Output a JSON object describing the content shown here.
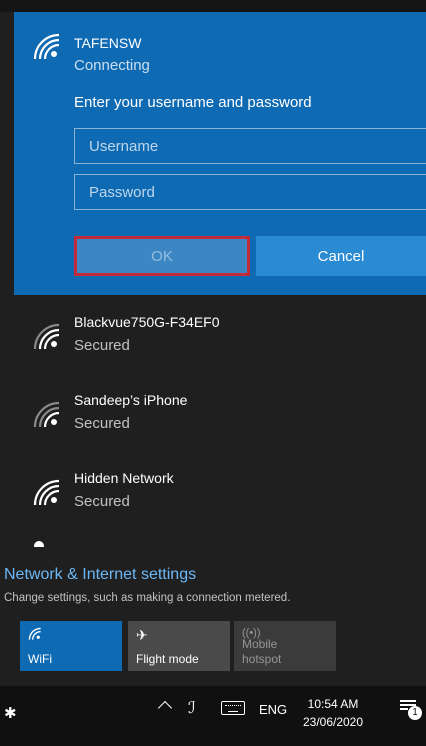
{
  "active_network": {
    "name": "TAFENSW",
    "status": "Connecting",
    "prompt": "Enter your username and password",
    "username_placeholder": "Username",
    "password_placeholder": "Password",
    "ok_label": "OK",
    "cancel_label": "Cancel"
  },
  "networks": [
    {
      "name": "Blackvue750G-F34EF0",
      "status": "Secured"
    },
    {
      "name": "Sandeep’s iPhone",
      "status": "Secured"
    },
    {
      "name": "Hidden Network",
      "status": "Secured"
    }
  ],
  "settings": {
    "link": "Network & Internet settings",
    "description": "Change settings, such as making a connection metered."
  },
  "quick_actions": {
    "wifi": {
      "icon": "wifi-icon",
      "label": "WiFi"
    },
    "flight": {
      "icon": "airplane-icon",
      "label": "Flight mode"
    },
    "hotspot": {
      "icon": "hotspot-icon",
      "label_line1": "Mobile",
      "label_line2": "hotspot"
    }
  },
  "taskbar": {
    "language": "ENG",
    "time": "10:54 AM",
    "date": "23/06/2020",
    "notification_count": "1"
  },
  "colors": {
    "accent": "#0f6ab4",
    "link": "#6cb8f6",
    "highlight_border": "#c32a3a",
    "background": "#1f1f1f"
  }
}
